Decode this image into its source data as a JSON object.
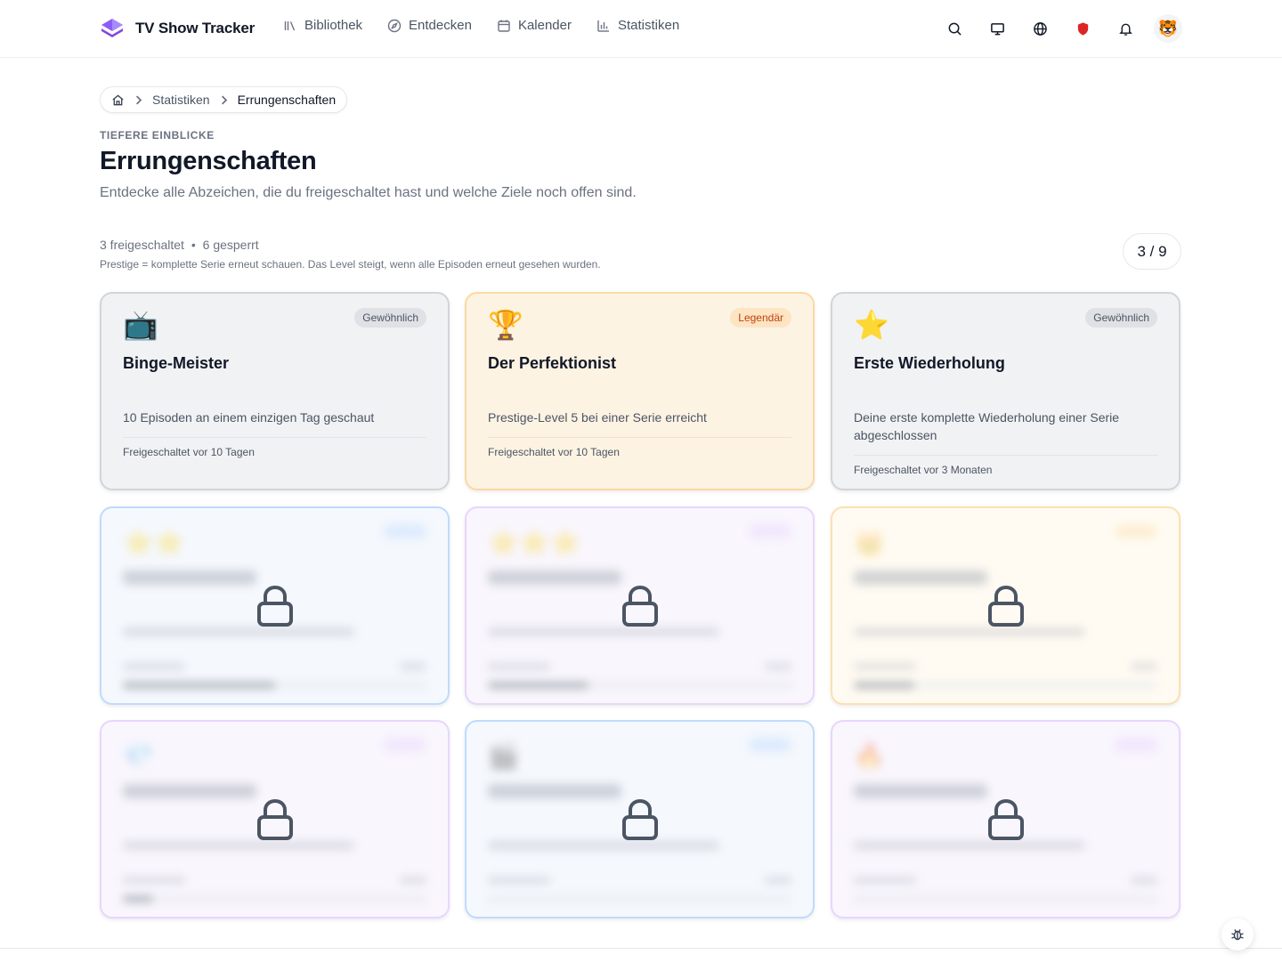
{
  "app": {
    "name": "TV Show Tracker"
  },
  "nav": [
    {
      "label": "Bibliothek",
      "icon": "library-icon"
    },
    {
      "label": "Entdecken",
      "icon": "compass-icon"
    },
    {
      "label": "Kalender",
      "icon": "calendar-icon"
    },
    {
      "label": "Statistiken",
      "icon": "bar-chart-icon"
    }
  ],
  "header_icons": [
    "search-icon",
    "monitor-icon",
    "globe-icon",
    "shield-icon",
    "bell-icon",
    "avatar"
  ],
  "avatar_emoji": "🐯",
  "breadcrumb": {
    "items": [
      "Statistiken"
    ],
    "current": "Errungenschaften"
  },
  "page": {
    "eyebrow": "TIEFERE EINBLICKE",
    "title": "Errungenschaften",
    "subtitle": "Entdecke alle Abzeichen, die du freigeschaltet hast und welche Ziele noch offen sind."
  },
  "summary": {
    "unlocked": "3 freigeschaltet",
    "separator": "•",
    "locked": "6 gesperrt",
    "hint": "Prestige = komplette Serie erneut schauen. Das Level steigt, wenn alle Episoden erneut gesehen wurden.",
    "counter": "3 / 9"
  },
  "unlocked_cards": [
    {
      "emoji": "📺",
      "rarity": "Gewöhnlich",
      "title": "Binge-Meister",
      "description": "10 Episoden an einem einzigen Tag geschaut",
      "unlocked_text": "Freigeschaltet vor 10 Tagen",
      "style": "common"
    },
    {
      "emoji": "🏆",
      "rarity": "Legendär",
      "title": "Der Perfektionist",
      "description": "Prestige-Level 5 bei einer Serie erreicht",
      "unlocked_text": "Freigeschaltet vor 10 Tagen",
      "style": "legendary"
    },
    {
      "emoji": "⭐",
      "rarity": "Gewöhnlich",
      "title": "Erste Wiederholung",
      "description": "Deine erste komplette Wiederholung einer Serie abgeschlossen",
      "unlocked_text": "Freigeschaltet vor 3 Monaten",
      "style": "common"
    }
  ],
  "locked_cards": [
    {
      "emoji": "⭐⭐",
      "progress": 0.5,
      "border": "#bfdbfe",
      "bg": "#f5f8fd",
      "badge_color": "#bfdbfe"
    },
    {
      "emoji": "⭐⭐⭐",
      "progress": 0.33,
      "border": "#e9d5ff",
      "bg": "#f9f6fd",
      "badge_color": "#e9d5ff"
    },
    {
      "emoji": "👑",
      "progress": 0.2,
      "border": "#fde0b0",
      "bg": "#fffbf3",
      "badge_color": "#fde0b0"
    },
    {
      "emoji": "💎",
      "progress": 0.1,
      "border": "#e9d5ff",
      "bg": "#f9f6fd",
      "badge_color": "#e9d5ff"
    },
    {
      "emoji": "🎬",
      "progress": 0.0,
      "border": "#bfdbfe",
      "bg": "#f5f8fd",
      "badge_color": "#bfdbfe"
    },
    {
      "emoji": "🔥",
      "progress": 0.0,
      "border": "#e9d5ff",
      "bg": "#f9f6fd",
      "badge_color": "#e9d5ff"
    }
  ],
  "colors": {
    "accent": "#7c3aed",
    "legendary": "#c2410c",
    "shield": "#dc2626"
  }
}
